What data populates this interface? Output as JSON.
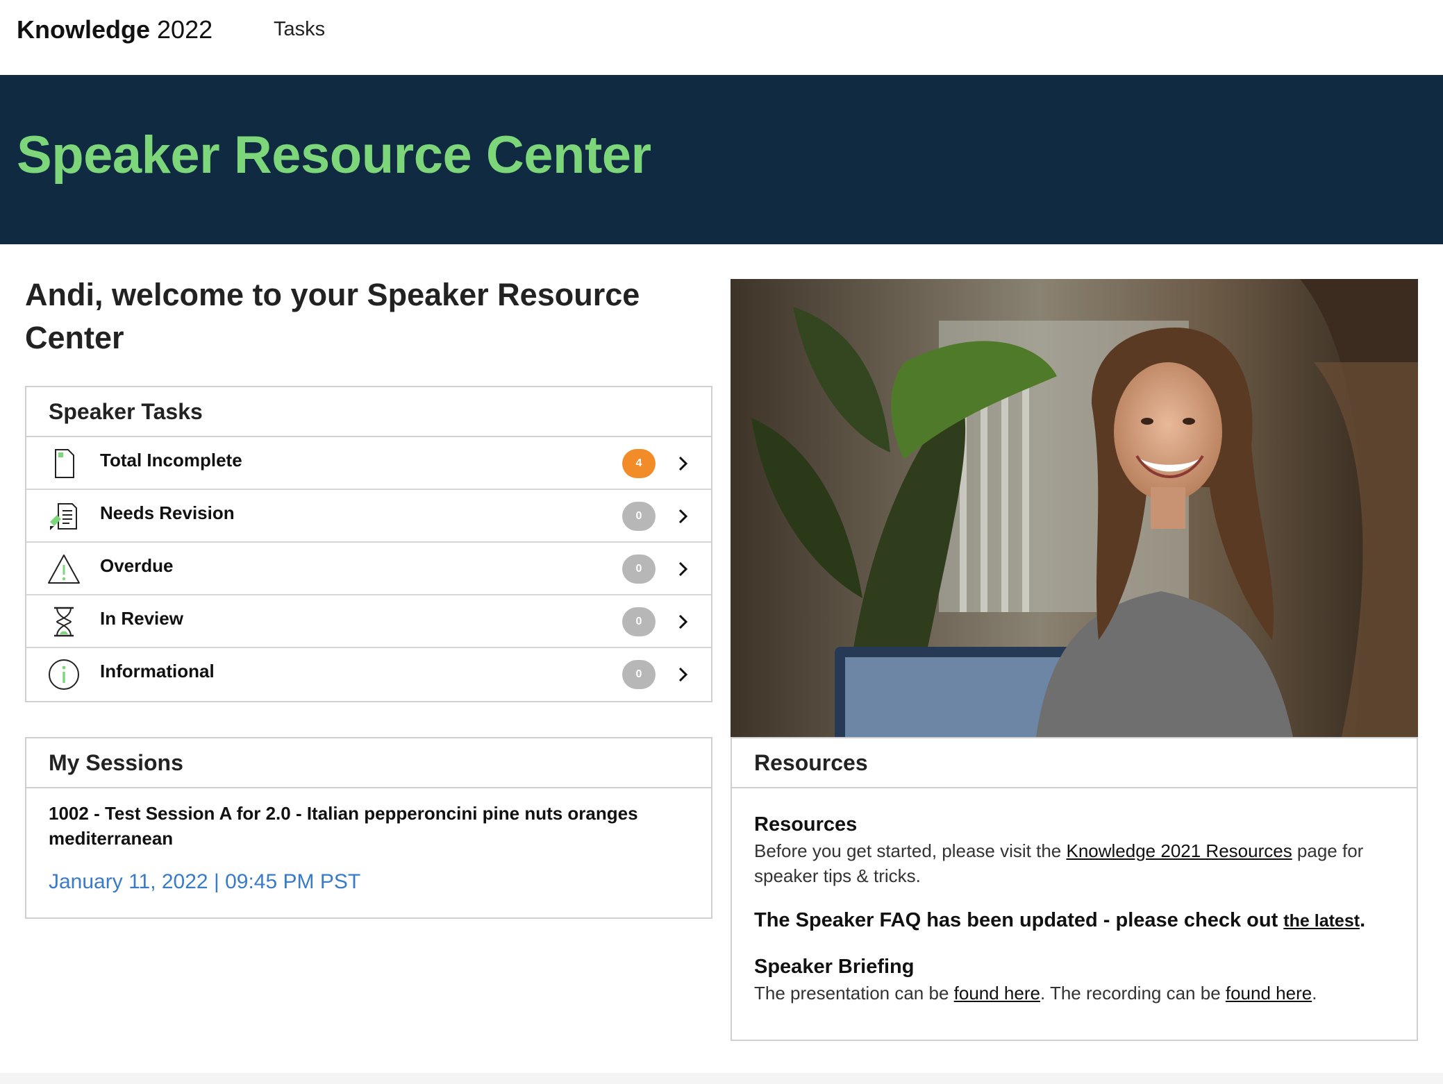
{
  "nav": {
    "brand_strong": "Knowledge",
    "brand_light": "2022",
    "tasks_link": "Tasks"
  },
  "hero": {
    "title": "Speaker Resource Center"
  },
  "welcome": "Andi, welcome to your Speaker Resource Center",
  "speaker_tasks": {
    "title": "Speaker Tasks",
    "rows": [
      {
        "label": "Total Incomplete",
        "count": "4",
        "icon": "document-icon"
      },
      {
        "label": "Needs Revision",
        "count": "0",
        "icon": "revision-icon"
      },
      {
        "label": "Overdue",
        "count": "0",
        "icon": "warning-icon"
      },
      {
        "label": "In Review",
        "count": "0",
        "icon": "hourglass-icon"
      },
      {
        "label": "Informational",
        "count": "0",
        "icon": "info-icon"
      }
    ]
  },
  "my_sessions": {
    "title": "My Sessions",
    "session_title": "1002 - Test Session A for 2.0 - Italian pepperoncini pine nuts oranges mediterranean",
    "session_date": "January 11, 2022 | 09:45 PM PST"
  },
  "resources": {
    "title": "Resources",
    "section1_heading": "Resources",
    "section1_text_before": "Before you get started, please visit the ",
    "section1_link": "Knowledge 2021 Resources",
    "section1_text_after": " page for speaker tips & tricks.",
    "faq_text": "The Speaker FAQ has been updated - please check out ",
    "faq_link": "the latest",
    "faq_end": ".",
    "briefing_heading": "Speaker Briefing",
    "briefing_text1": "The presentation can be ",
    "briefing_link1": "found here",
    "briefing_text2": ". The recording can be ",
    "briefing_link2": "found here",
    "briefing_text3": "."
  },
  "colors": {
    "hero_bg": "#0f2a41",
    "hero_title": "#7ed67a",
    "badge_active": "#f28c28",
    "badge_inactive": "#b7b7b7",
    "date_link": "#3a7bc8"
  }
}
